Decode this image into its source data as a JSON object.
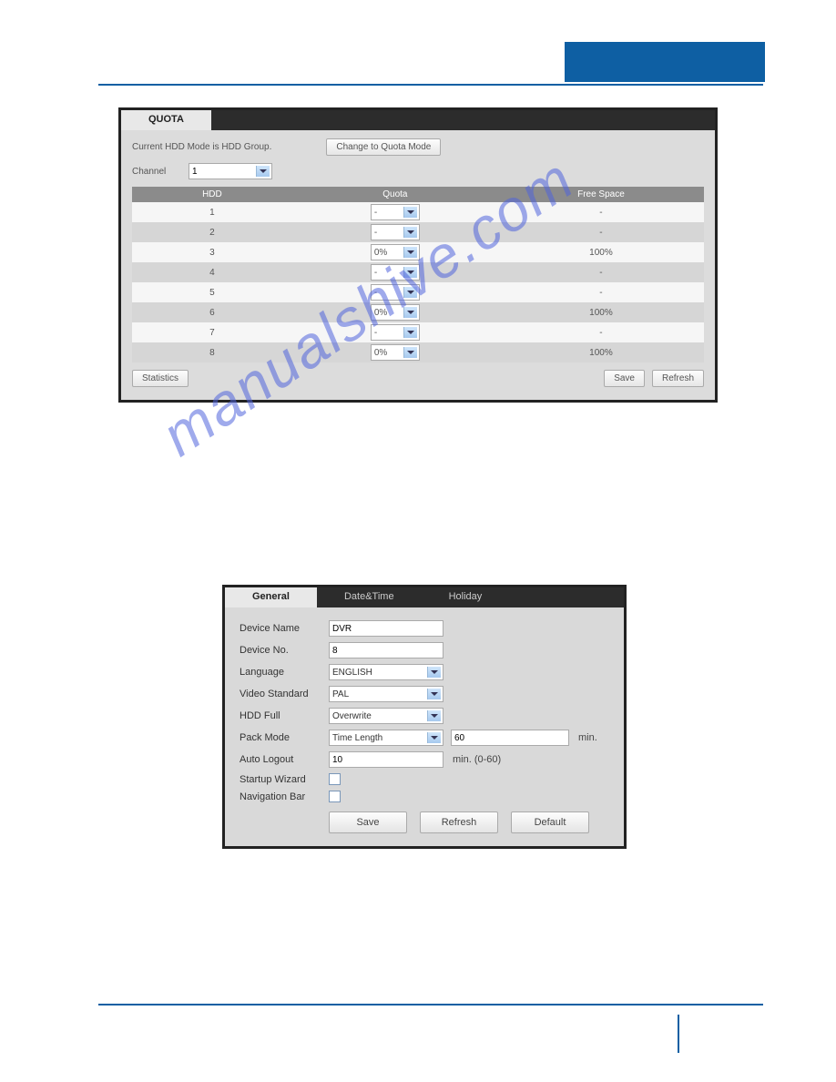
{
  "watermark": "manualshive.com",
  "quota": {
    "tab_label": "QUOTA",
    "mode_note": "Current HDD Mode is HDD Group.",
    "change_mode_label": "Change to Quota Mode",
    "channel_label": "Channel",
    "channel_value": "1",
    "headers": {
      "hdd": "HDD",
      "quota": "Quota",
      "free": "Free Space"
    },
    "rows": [
      {
        "hdd": "1",
        "quota": "-",
        "free": "-"
      },
      {
        "hdd": "2",
        "quota": "-",
        "free": "-"
      },
      {
        "hdd": "3",
        "quota": "0%",
        "free": "100%"
      },
      {
        "hdd": "4",
        "quota": "-",
        "free": "-"
      },
      {
        "hdd": "5",
        "quota": "-",
        "free": "-"
      },
      {
        "hdd": "6",
        "quota": "0%",
        "free": "100%"
      },
      {
        "hdd": "7",
        "quota": "-",
        "free": "-"
      },
      {
        "hdd": "8",
        "quota": "0%",
        "free": "100%"
      }
    ],
    "statistics_label": "Statistics",
    "save_label": "Save",
    "refresh_label": "Refresh"
  },
  "general": {
    "tabs": {
      "general": "General",
      "datetime": "Date&Time",
      "holiday": "Holiday"
    },
    "fields": {
      "device_name_label": "Device Name",
      "device_name_value": "DVR",
      "device_no_label": "Device No.",
      "device_no_value": "8",
      "language_label": "Language",
      "language_value": "ENGLISH",
      "video_std_label": "Video Standard",
      "video_std_value": "PAL",
      "hdd_full_label": "HDD Full",
      "hdd_full_value": "Overwrite",
      "pack_mode_label": "Pack Mode",
      "pack_mode_value": "Time Length",
      "pack_mode_num": "60",
      "pack_mode_unit": "min.",
      "auto_logout_label": "Auto Logout",
      "auto_logout_value": "10",
      "auto_logout_unit": "min. (0-60)",
      "startup_wizard_label": "Startup Wizard",
      "nav_bar_label": "Navigation Bar"
    },
    "buttons": {
      "save": "Save",
      "refresh": "Refresh",
      "default": "Default"
    }
  }
}
